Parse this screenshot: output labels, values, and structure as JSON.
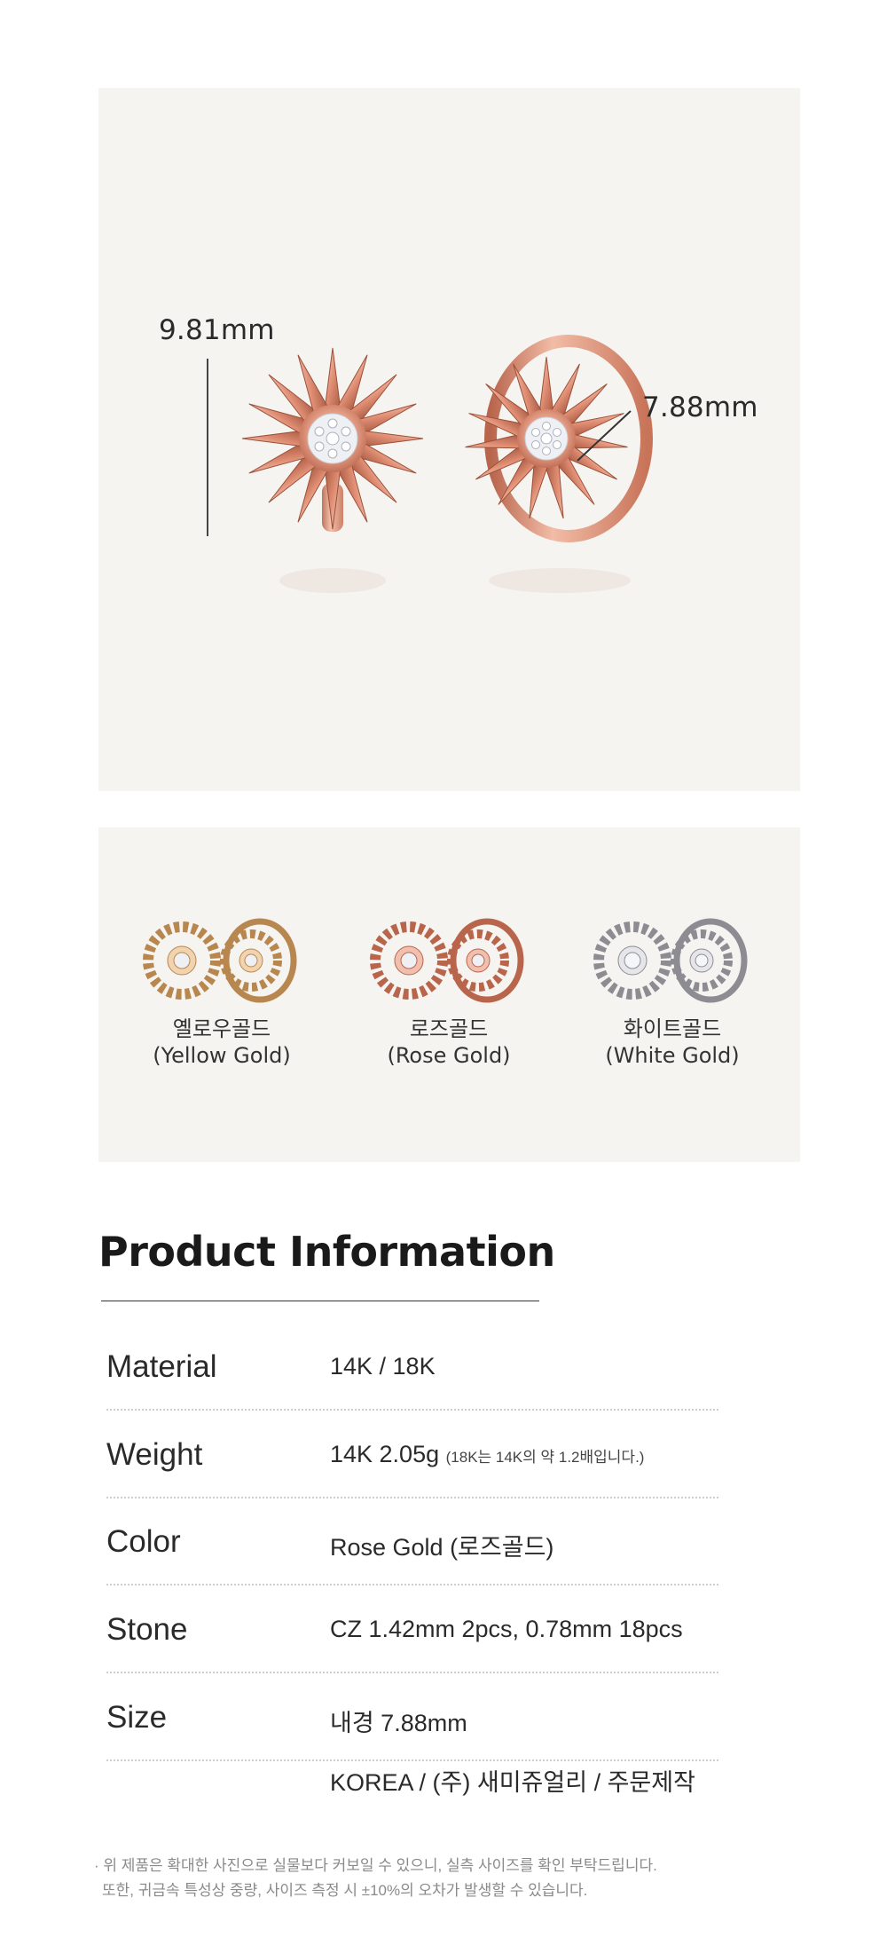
{
  "hero": {
    "height_dimension": "9.81mm",
    "inner_diameter_dimension": "7.88mm"
  },
  "colors": {
    "options": [
      {
        "name_ko": "옐로우골드",
        "name_en": "(Yellow Gold)",
        "metal_color": "#e6b98a"
      },
      {
        "name_ko": "로즈골드",
        "name_en": "(Rose Gold)",
        "metal_color": "#e39a82"
      },
      {
        "name_ko": "화이트골드",
        "name_en": "(White Gold)",
        "metal_color": "#cfcfd3"
      }
    ]
  },
  "product_info": {
    "title": "Product Information",
    "rows": [
      {
        "label": "Material",
        "value": "14K / 18K",
        "note": ""
      },
      {
        "label": "Weight",
        "value": "14K 2.05g",
        "note": "(18K는 14K의 약 1.2배입니다.)"
      },
      {
        "label": "Color",
        "value": "Rose Gold (로즈골드)",
        "note": ""
      },
      {
        "label": "Stone",
        "value": "CZ 1.42mm 2pcs, 0.78mm 18pcs",
        "note": ""
      },
      {
        "label": "Size",
        "value": "내경 7.88mm",
        "note": ""
      }
    ],
    "origin": "KOREA / (주) 새미쥬얼리 / 주문제작"
  },
  "notices": [
    "· 위 제품은 확대한 사진으로 실물보다 커보일 수 있으니, 실측 사이즈를 확인 부탁드립니다.",
    "또한, 귀금속 특성상 중량,  사이즈 측정 시 ±10%의 오차가 발생할 수 있습니다."
  ],
  "palette": {
    "panel_bg": "#f6f4f0",
    "rose_gold": "#e39a82",
    "rose_gold_dark": "#b8654c"
  }
}
